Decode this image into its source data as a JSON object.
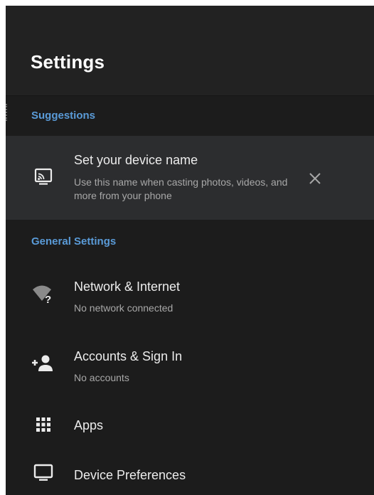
{
  "header": {
    "title": "Settings"
  },
  "suggestions": {
    "header": "Suggestions",
    "item": {
      "icon": "cast-icon",
      "title": "Set your device name",
      "subtitle": "Use this name when casting photos, videos, and more from your phone",
      "dismiss_icon": "close-icon"
    }
  },
  "general": {
    "header": "General Settings",
    "items": [
      {
        "icon": "wifi-question-icon",
        "title": "Network & Internet",
        "subtitle": "No network connected"
      },
      {
        "icon": "add-person-icon",
        "title": "Accounts & Sign In",
        "subtitle": "No accounts"
      },
      {
        "icon": "apps-grid-icon",
        "title": "Apps",
        "subtitle": ""
      },
      {
        "icon": "tv-icon",
        "title": "Device Preferences",
        "subtitle": ""
      }
    ]
  },
  "colors": {
    "background": "#1c1c1c",
    "header_background": "#222222",
    "highlight_row": "#2c2d2f",
    "section_accent": "#5a9bd8",
    "primary_text": "#ececec",
    "secondary_text": "#a8a8a8"
  }
}
